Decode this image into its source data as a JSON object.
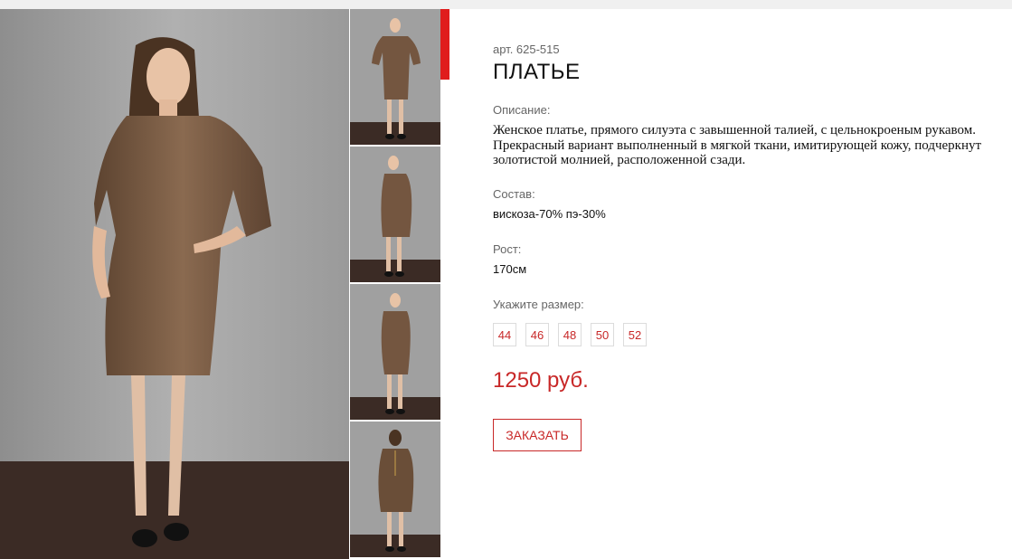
{
  "product": {
    "article": "арт. 625-515",
    "title": "ПЛАТЬЕ"
  },
  "description": {
    "label": "Описание:",
    "lines": [
      "Женское платье, прямого силуэта с завышенной талией, с цельнокроеным рукавом.",
      "Прекрасный вариант выполненный в мягкой ткани, имитирующей кожу, подчеркнут",
      "золотистой молнией, расположенной сзади."
    ]
  },
  "composition": {
    "label": "Состав:",
    "value": "вискоза-70% пэ-30%"
  },
  "height": {
    "label": "Рост:",
    "value": "170см"
  },
  "sizes": {
    "label": "Укажите размер:",
    "options": [
      "44",
      "46",
      "48",
      "50",
      "52"
    ]
  },
  "price": "1250 руб.",
  "order_button": "ЗАКАЗАТЬ",
  "colors": {
    "accent": "#c82828",
    "accent_bar": "#e01d1d",
    "dress": "#7a5a40",
    "wall": "#9c9c9c",
    "floor": "#3a2a24"
  }
}
